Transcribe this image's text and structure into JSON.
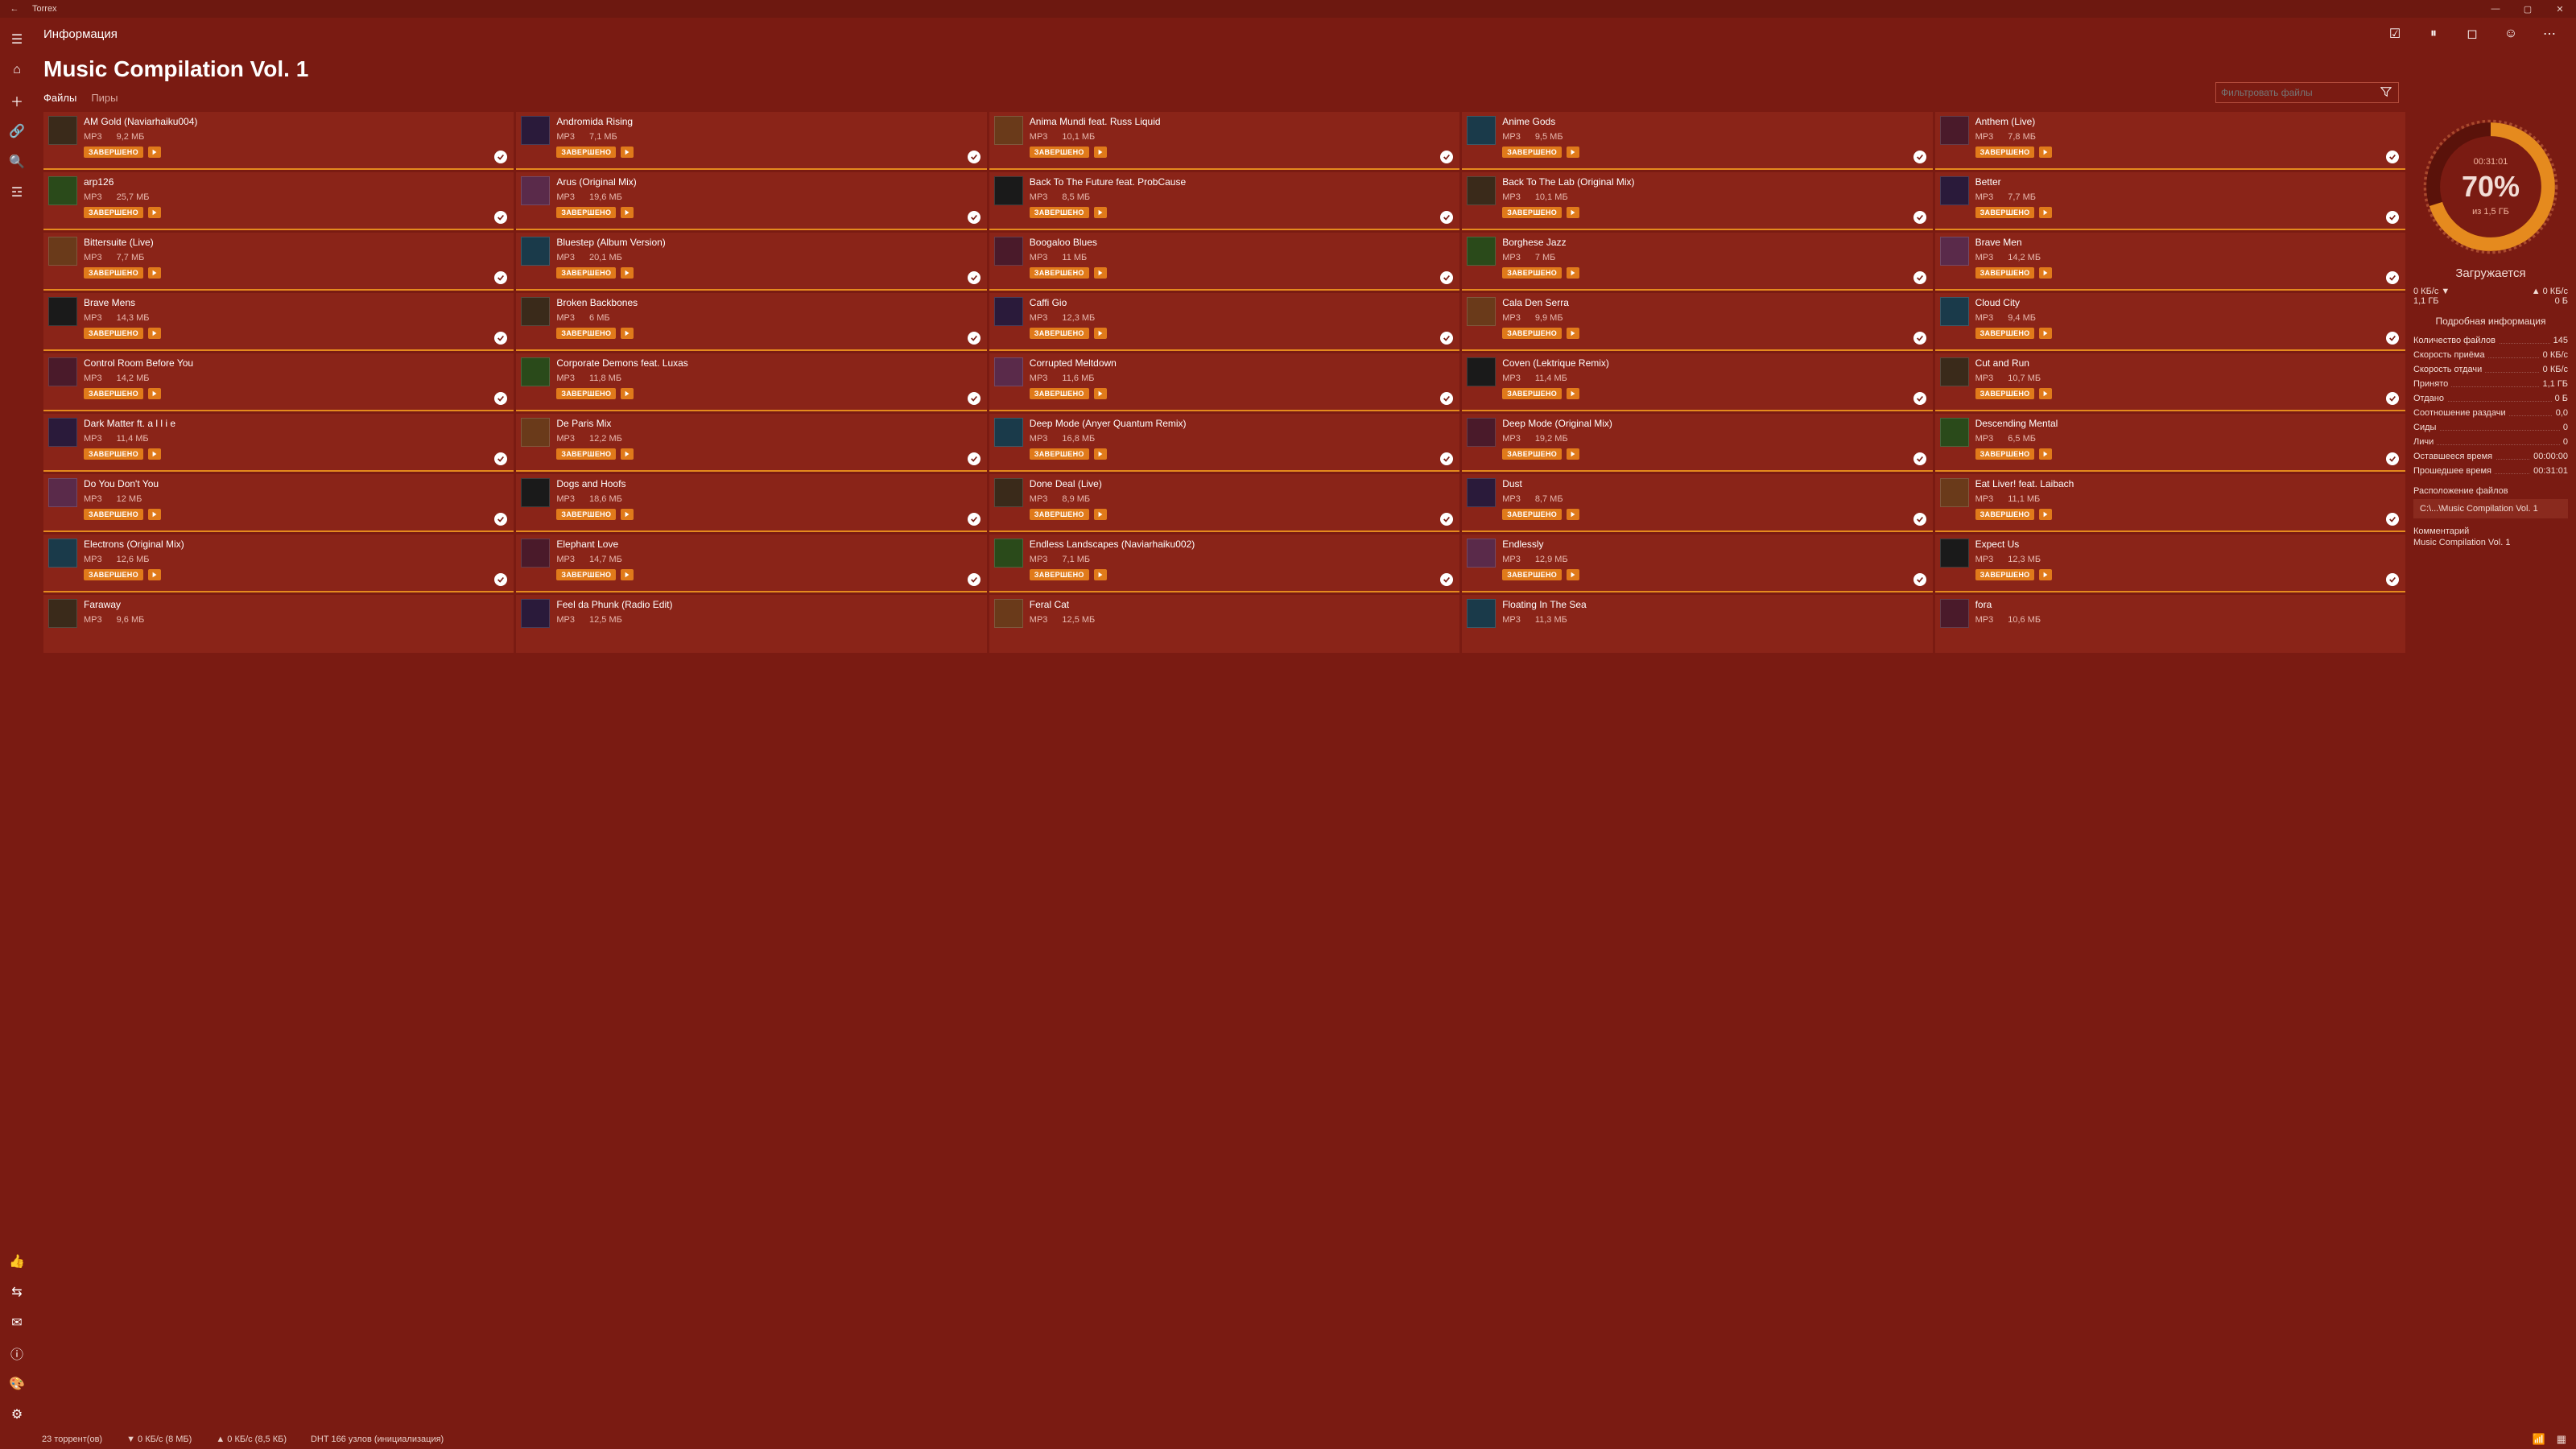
{
  "titlebar": {
    "app": "Torrex"
  },
  "header": {
    "subtitle": "Информация",
    "title": "Music Compilation Vol. 1"
  },
  "tabs": {
    "files": "Файлы",
    "peers": "Пиры"
  },
  "filter": {
    "placeholder": "Фильтровать файлы"
  },
  "labels": {
    "completed": "ЗАВЕРШЕНО",
    "mp3": "MP3"
  },
  "tracks": [
    {
      "title": "AM Gold (Naviarhaiku004)",
      "size": "9,2 МБ"
    },
    {
      "title": "Andromida Rising",
      "size": "7,1 МБ"
    },
    {
      "title": "Anima Mundi feat. Russ Liquid",
      "size": "10,1 МБ"
    },
    {
      "title": "Anime Gods",
      "size": "9,5 МБ"
    },
    {
      "title": "Anthem (Live)",
      "size": "7,8 МБ"
    },
    {
      "title": "arp126",
      "size": "25,7 МБ"
    },
    {
      "title": "Arus (Original Mix)",
      "size": "19,6 МБ"
    },
    {
      "title": "Back To The Future feat. ProbCause",
      "size": "8,5 МБ"
    },
    {
      "title": "Back To The Lab (Original Mix)",
      "size": "10,1 МБ"
    },
    {
      "title": "Better",
      "size": "7,7 МБ"
    },
    {
      "title": "Bittersuite (Live)",
      "size": "7,7 МБ"
    },
    {
      "title": "Bluestep (Album Version)",
      "size": "20,1 МБ"
    },
    {
      "title": "Boogaloo Blues",
      "size": "11 МБ"
    },
    {
      "title": "Borghese Jazz",
      "size": "7 МБ"
    },
    {
      "title": "Brave Men",
      "size": "14,2 МБ"
    },
    {
      "title": "Brave Mens",
      "size": "14,3 МБ"
    },
    {
      "title": "Broken Backbones",
      "size": "6 МБ"
    },
    {
      "title": "Caffi Gio",
      "size": "12,3 МБ"
    },
    {
      "title": "Cala Den Serra",
      "size": "9,9 МБ"
    },
    {
      "title": "Cloud City",
      "size": "9,4 МБ"
    },
    {
      "title": "Control Room Before You",
      "size": "14,2 МБ"
    },
    {
      "title": "Corporate Demons feat. Luxas",
      "size": "11,8 МБ"
    },
    {
      "title": "Corrupted Meltdown",
      "size": "11,6 МБ"
    },
    {
      "title": "Coven (Lektrique Remix)",
      "size": "11,4 МБ"
    },
    {
      "title": "Cut and Run",
      "size": "10,7 МБ"
    },
    {
      "title": "Dark Matter ft. a l l i e",
      "size": "11,4 МБ"
    },
    {
      "title": "De Paris Mix",
      "size": "12,2 МБ"
    },
    {
      "title": "Deep Mode (Anyer Quantum Remix)",
      "size": "16,8 МБ"
    },
    {
      "title": "Deep Mode (Original Mix)",
      "size": "19,2 МБ"
    },
    {
      "title": "Descending Mental",
      "size": "6,5 МБ"
    },
    {
      "title": "Do You Don't You",
      "size": "12 МБ"
    },
    {
      "title": "Dogs and Hoofs",
      "size": "18,6 МБ"
    },
    {
      "title": "Done Deal (Live)",
      "size": "8,9 МБ"
    },
    {
      "title": "Dust",
      "size": "8,7 МБ"
    },
    {
      "title": "Eat Liver! feat. Laibach",
      "size": "11,1 МБ"
    },
    {
      "title": "Electrons (Original Mix)",
      "size": "12,6 МБ"
    },
    {
      "title": "Elephant Love",
      "size": "14,7 МБ"
    },
    {
      "title": "Endless Landscapes (Naviarhaiku002)",
      "size": "7,1 МБ"
    },
    {
      "title": "Endlessly",
      "size": "12,9 МБ"
    },
    {
      "title": "Expect Us",
      "size": "12,3 МБ"
    },
    {
      "title": "Faraway",
      "size": "9,6 МБ"
    },
    {
      "title": "Feel da Phunk (Radio Edit)",
      "size": "12,5 МБ"
    },
    {
      "title": "Feral Cat",
      "size": "12,5 МБ"
    },
    {
      "title": "Floating In The Sea",
      "size": "11,3 МБ"
    },
    {
      "title": "fora",
      "size": "10,6 МБ"
    }
  ],
  "progress": {
    "elapsed": "00:31:01",
    "percent": "70%",
    "total_of": "из 1,5 ГБ",
    "status": "Загружается",
    "down_speed": "0 КБ/с ▼",
    "down_total": "1,1 ГБ",
    "up_speed": "▲  0 КБ/с",
    "up_total": "0 Б"
  },
  "details": {
    "heading": "Подробная информация",
    "rows": [
      {
        "k": "Количество файлов",
        "v": "145"
      },
      {
        "k": "Скорость приёма",
        "v": "0 КБ/с"
      },
      {
        "k": "Скорость отдачи",
        "v": "0 КБ/с"
      },
      {
        "k": "Принято",
        "v": "1,1 ГБ"
      },
      {
        "k": "Отдано",
        "v": "0 Б"
      },
      {
        "k": "Соотношение раздачи",
        "v": "0,0"
      },
      {
        "k": "Сиды",
        "v": "0"
      },
      {
        "k": "Личи",
        "v": "0"
      },
      {
        "k": "Оставшееся время",
        "v": "00:00:00"
      },
      {
        "k": "Прошедшее время",
        "v": "00:31:01"
      }
    ],
    "location_label": "Расположение файлов",
    "location_value": "C:\\...\\Music Compilation Vol. 1",
    "comment_label": "Комментарий",
    "comment_value": "Music Compilation Vol. 1"
  },
  "statusbar": {
    "torrents": "23 торрент(ов)",
    "down": "▼ 0 КБ/с (8 МБ)",
    "up": "▲ 0 КБ/с (8,5 КБ)",
    "dht": "DHT 166 узлов (инициализация)"
  }
}
